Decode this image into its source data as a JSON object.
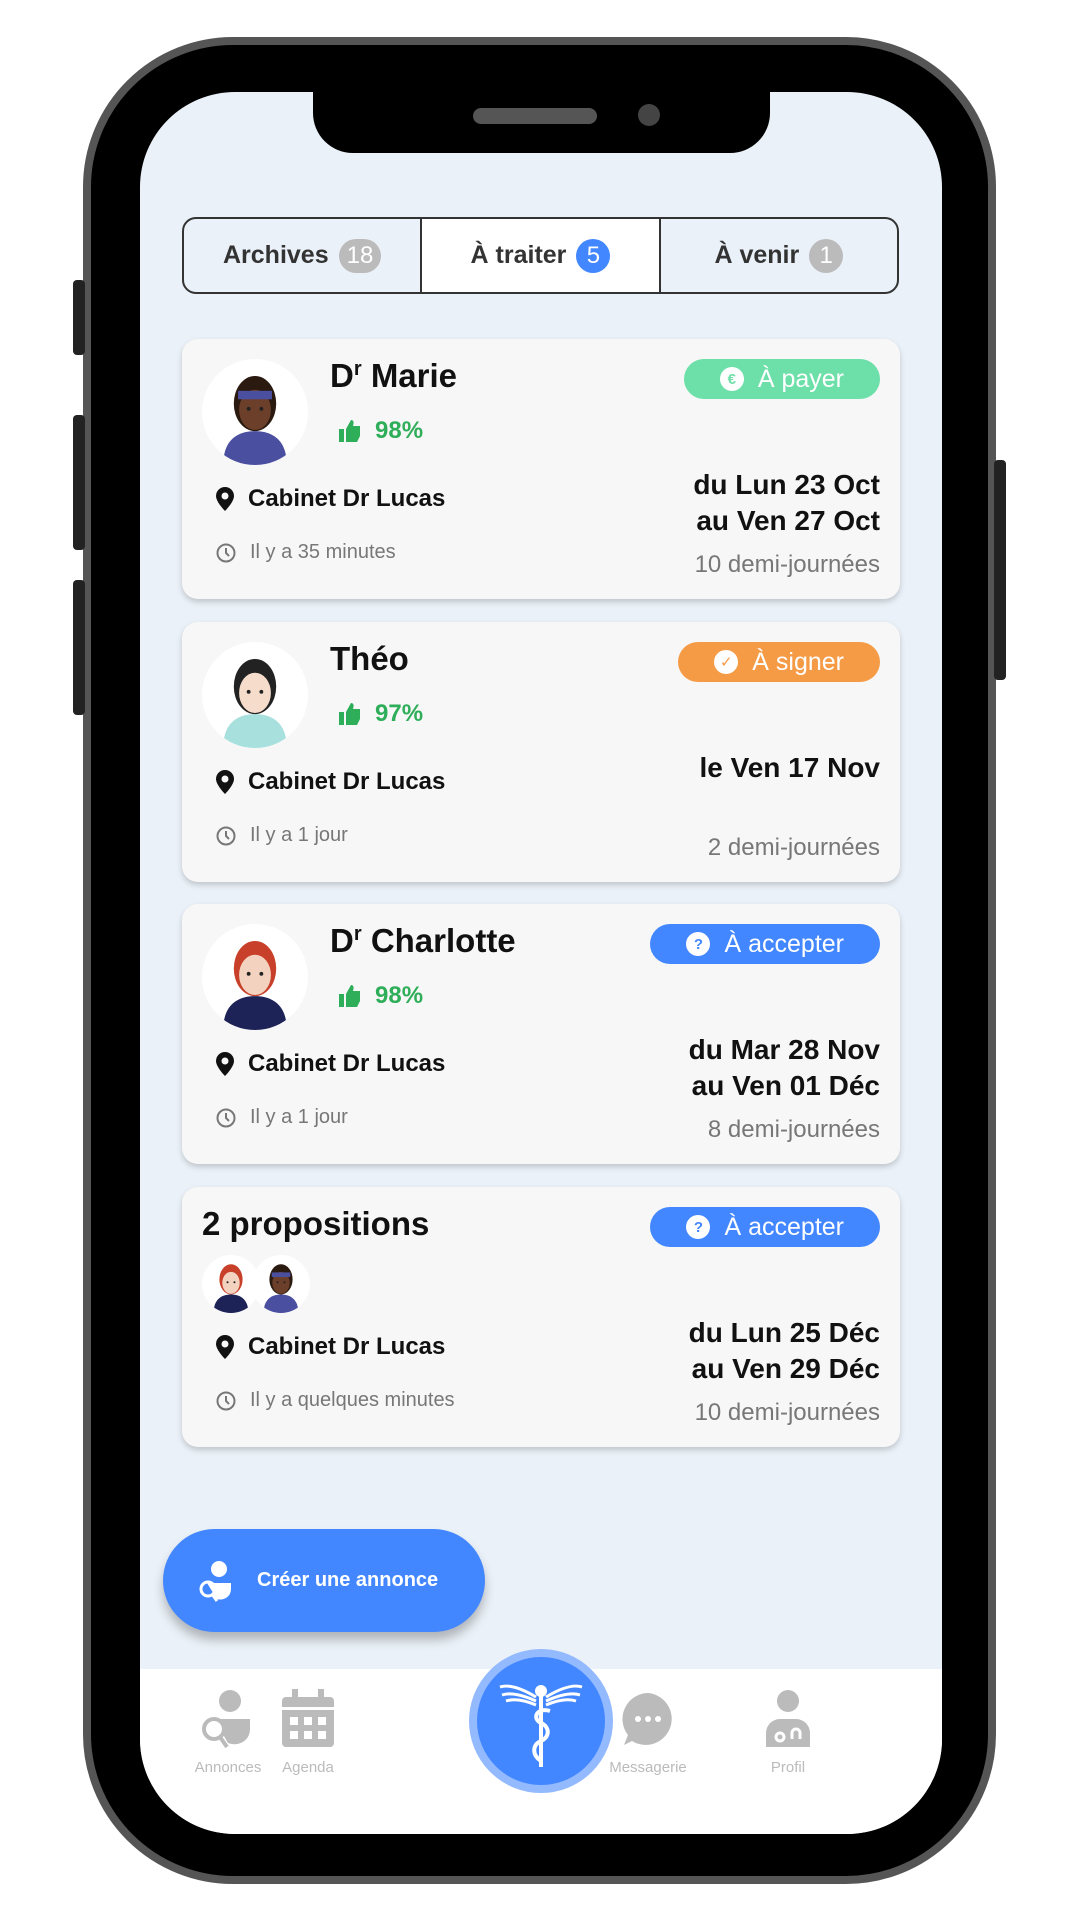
{
  "colors": {
    "accent": "#4287ff",
    "green": "#6ddfa8",
    "orange": "#f59a45",
    "rating": "#2fae59"
  },
  "tabs": [
    {
      "label": "Archives",
      "count": "18"
    },
    {
      "label": "À traiter",
      "count": "5",
      "active": true
    },
    {
      "label": "À venir",
      "count": "1"
    }
  ],
  "cards": [
    {
      "title_prefix": "D",
      "title_sup": "r",
      "title": "Marie",
      "rating": "98%",
      "status": "À payer",
      "status_icon": "euro-icon",
      "location": "Cabinet Dr Lucas",
      "time": "Il y a 35 minutes",
      "date1": "du Lun 23 Oct",
      "date2": "au Ven 27 Oct",
      "halfdays": "10 demi-journées"
    },
    {
      "title": "Théo",
      "rating": "97%",
      "status": "À signer",
      "status_icon": "check-icon",
      "location": "Cabinet Dr Lucas",
      "time": "Il y a 1 jour",
      "date1": "le Ven 17 Nov",
      "halfdays": "2 demi-journées"
    },
    {
      "title_prefix": "D",
      "title_sup": "r",
      "title": "Charlotte",
      "rating": "98%",
      "status": "À accepter",
      "status_icon": "question-icon",
      "location": "Cabinet Dr Lucas",
      "time": "Il y a 1 jour",
      "date1": "du Mar 28 Nov",
      "date2": "au Ven 01 Déc",
      "halfdays": "8 demi-journées"
    },
    {
      "title": "2 propositions",
      "status": "À accepter",
      "status_icon": "question-icon",
      "location": "Cabinet Dr Lucas",
      "time": "Il y a quelques minutes",
      "date1": "du Lun 25 Déc",
      "date2": "au Ven 29 Déc",
      "halfdays": "10 demi-journées"
    }
  ],
  "fab": {
    "label": "Créer une annonce"
  },
  "nav": [
    {
      "label": "Annonces"
    },
    {
      "label": "Agenda"
    },
    {
      "label": "Messagerie"
    },
    {
      "label": "Profil"
    }
  ]
}
